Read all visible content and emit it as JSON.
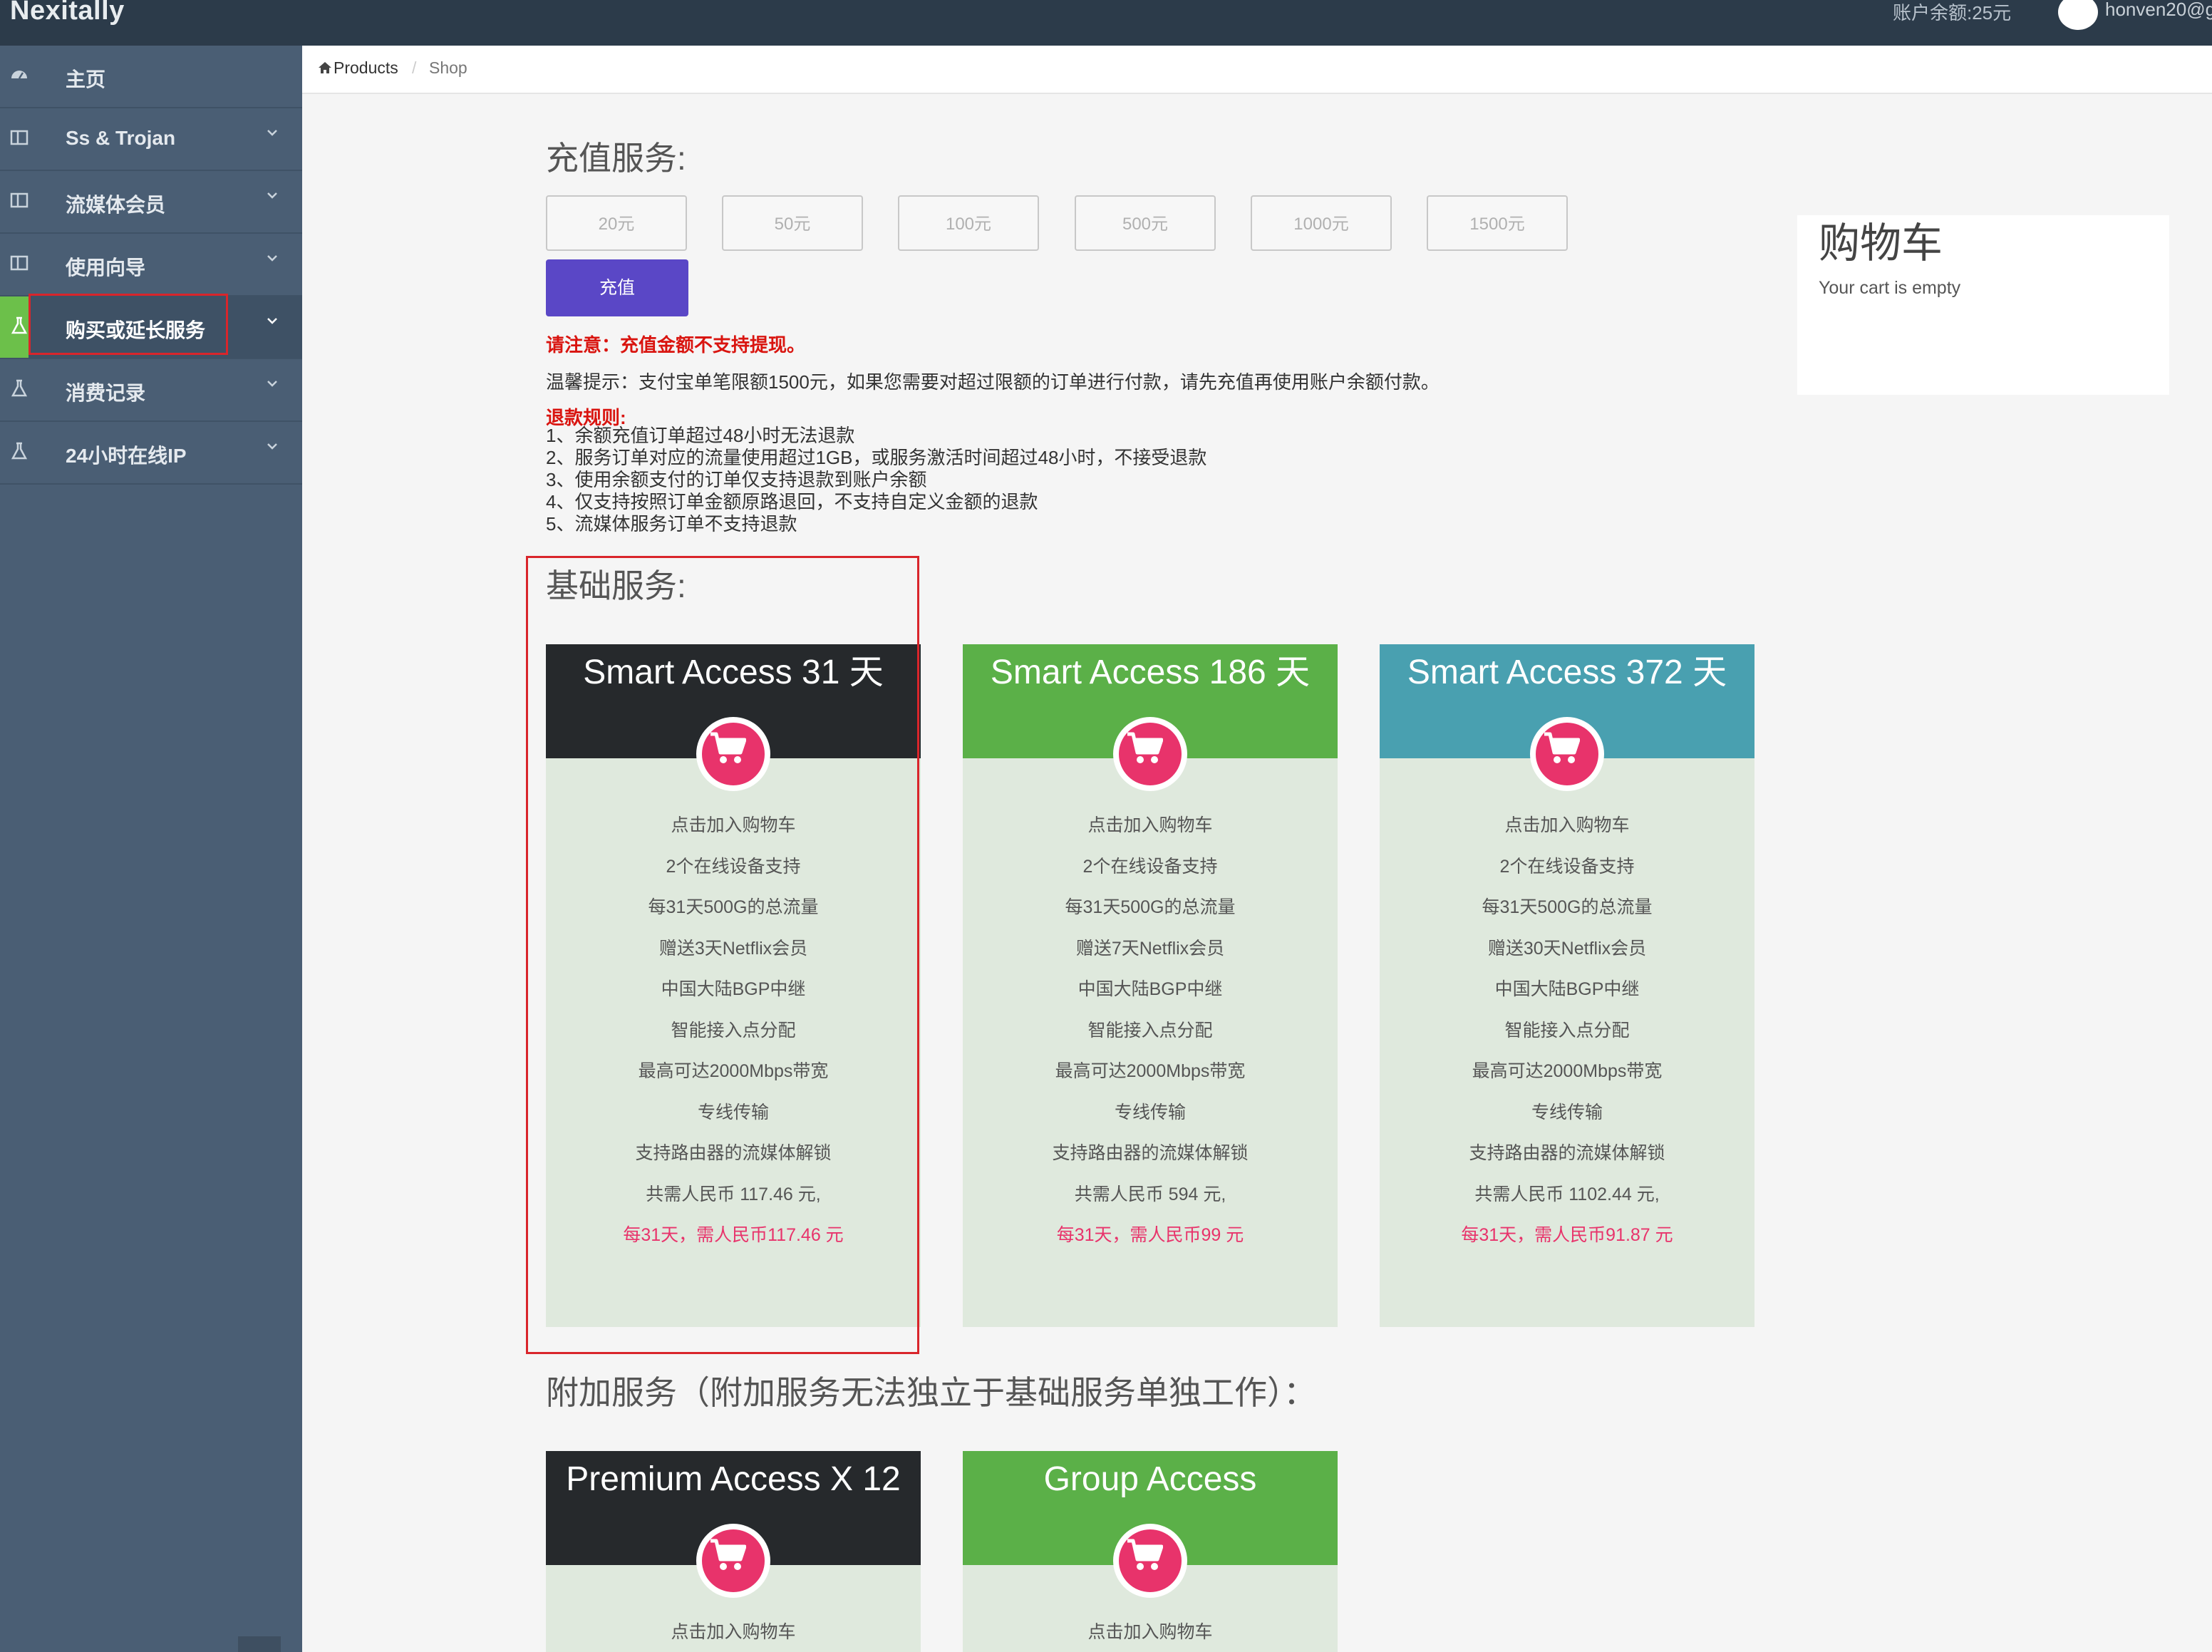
{
  "topbar": {
    "brand": "Nexitally",
    "balance": "账户余额:25元",
    "username": "honven20@g"
  },
  "sidebar": {
    "items": [
      {
        "label": "主页",
        "icon": "dashboard-icon",
        "has_chevron": false
      },
      {
        "label": "Ss & Trojan",
        "icon": "panel-icon",
        "has_chevron": true
      },
      {
        "label": "流媒体会员",
        "icon": "panel-icon",
        "has_chevron": true
      },
      {
        "label": "使用向导",
        "icon": "panel-icon",
        "has_chevron": true
      },
      {
        "label": "购买或延长服务",
        "icon": "flask-icon",
        "has_chevron": true,
        "active": true
      },
      {
        "label": "消费记录",
        "icon": "flask-icon",
        "has_chevron": true
      },
      {
        "label": "24小时在线IP",
        "icon": "flask-icon",
        "has_chevron": true
      }
    ]
  },
  "breadcrumb": {
    "products": "Products",
    "separator": "/",
    "shop": "Shop"
  },
  "recharge": {
    "title": "充值服务:",
    "amounts": [
      "20元",
      "50元",
      "100元",
      "500元",
      "1000元",
      "1500元"
    ],
    "button": "充值",
    "warning": "请注意：充值金额不支持提现。",
    "tip": "温馨提示：支付宝单笔限额1500元，如果您需要对超过限额的订单进行付款，请先充值再使用账户余额付款。",
    "refund_title": "退款规则:",
    "refund_rules": [
      "1、余额充值订单超过48小时无法退款",
      "2、服务订单对应的流量使用超过1GB，或服务激活时间超过48小时，不接受退款",
      "3、使用余额支付的订单仅支持退款到账户余额",
      "4、仅支持按照订单金额原路退回，不支持自定义金额的退款",
      "5、流媒体服务订单不支持退款"
    ]
  },
  "cart": {
    "title": "购物车",
    "empty_text": "Your cart is empty"
  },
  "basic": {
    "title": "基础服务:",
    "cards": [
      {
        "title": "Smart Access 31 天",
        "color": "#26292c",
        "features": [
          "点击加入购物车",
          "2个在线设备支持",
          "每31天500G的总流量",
          "赠送3天Netflix会员",
          "中国大陆BGP中继",
          "智能接入点分配",
          "最高可达2000Mbps带宽",
          "专线传输",
          "支持路由器的流媒体解锁",
          "共需人民币 117.46 元,"
        ],
        "price_note": "每31天，需人民币117.46 元"
      },
      {
        "title": "Smart Access 186 天",
        "color": "#5bb048",
        "features": [
          "点击加入购物车",
          "2个在线设备支持",
          "每31天500G的总流量",
          "赠送7天Netflix会员",
          "中国大陆BGP中继",
          "智能接入点分配",
          "最高可达2000Mbps带宽",
          "专线传输",
          "支持路由器的流媒体解锁",
          "共需人民币 594 元,"
        ],
        "price_note": "每31天，需人民币99 元"
      },
      {
        "title": "Smart Access 372 天",
        "color": "#49a0b0",
        "features": [
          "点击加入购物车",
          "2个在线设备支持",
          "每31天500G的总流量",
          "赠送30天Netflix会员",
          "中国大陆BGP中继",
          "智能接入点分配",
          "最高可达2000Mbps带宽",
          "专线传输",
          "支持路由器的流媒体解锁",
          "共需人民币 1102.44 元,"
        ],
        "price_note": "每31天，需人民币91.87 元"
      }
    ]
  },
  "addon": {
    "title": "附加服务（附加服务无法独立于基础服务单独工作）：",
    "cards": [
      {
        "title": "Premium Access X 12",
        "color": "#26292c",
        "features": [
          "点击加入购物车"
        ]
      },
      {
        "title": "Group Access",
        "color": "#5bb048",
        "features": [
          "点击加入购物车"
        ]
      }
    ]
  }
}
